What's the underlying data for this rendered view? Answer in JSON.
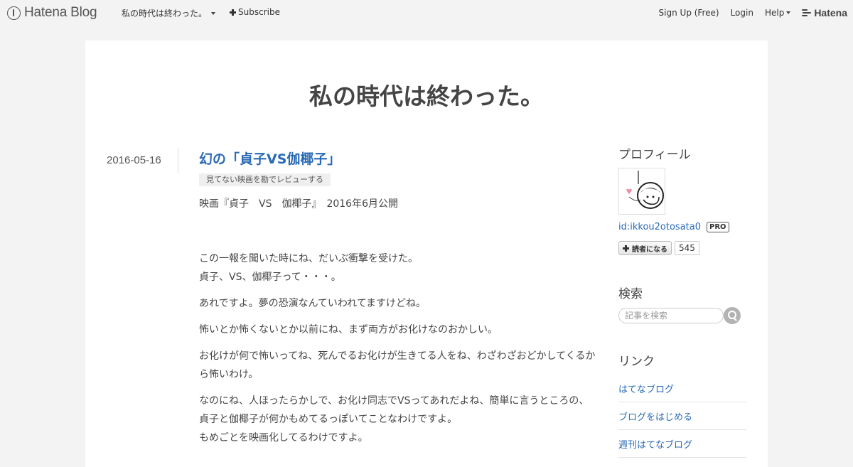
{
  "global_header": {
    "logo_text": "Hatena Blog",
    "blog_name": "私の時代は終わった。",
    "subscribe_label": "Subscribe",
    "signup_label": "Sign Up (Free)",
    "login_label": "Login",
    "help_label": "Help",
    "hatena_label": "Hatena"
  },
  "blog": {
    "title": "私の時代は終わった。"
  },
  "entry": {
    "date": "2016-05-16",
    "title": "幻の「貞子VS伽椰子」",
    "category": "見てない映画を勘でレビューする",
    "paragraphs": [
      "映画『貞子　VS　伽椰子』　2016年6月公開",
      "この一報を聞いた時にね、だいぶ衝撃を受けた。",
      "貞子、VS、伽椰子って・・・。",
      "あれですよ。夢の恐演なんていわれてますけどね。",
      "怖いとか怖くないとか以前にね、まず両方がお化けなのおかしい。",
      "お化けが何で怖いってね、死んでるお化けが生きてる人をね、わざわざおどかしてくるから怖いわけ。",
      "なのにね、人ほったらかしで、お化け同志でVSってあれだよね、簡単に言うところの、",
      "貞子と伽椰子が何かもめてるっぽいてことなわけですよ。",
      "もめごとを映画化してるわけですよ。"
    ]
  },
  "sidebar": {
    "profile": {
      "title": "プロフィール",
      "user_id": "id:ikkou2otosata0",
      "pro_badge": "PRO",
      "reader_button": "読者になる",
      "reader_count": "545"
    },
    "search": {
      "title": "検索",
      "placeholder": "記事を検索"
    },
    "links": {
      "title": "リンク",
      "items": [
        "はてなブログ",
        "ブログをはじめる",
        "週刊はてなブログ"
      ]
    }
  },
  "colors": {
    "page_bg": "#f3f3f3",
    "container_bg": "#ffffff",
    "link": "#2a6ab5",
    "text": "#454545"
  }
}
